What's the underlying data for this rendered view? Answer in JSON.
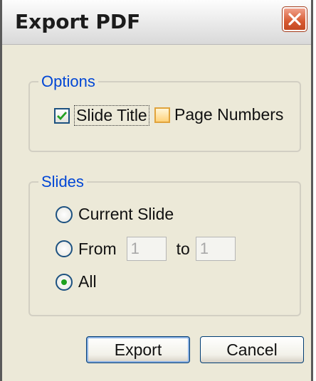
{
  "window": {
    "title": "Export PDF"
  },
  "options_group": {
    "legend": "Options",
    "slide_title": {
      "label": "Slide Title",
      "checked": true
    },
    "page_numbers": {
      "label": "Page Numbers",
      "checked": false
    }
  },
  "slides_group": {
    "legend": "Slides",
    "current_slide": {
      "label": "Current Slide",
      "selected": false
    },
    "from": {
      "label": "From",
      "selected": false,
      "value": "1"
    },
    "to": {
      "label": "to",
      "value": "1"
    },
    "all": {
      "label": "All",
      "selected": true
    }
  },
  "buttons": {
    "export_label": "Export",
    "cancel_label": "Cancel"
  },
  "icons": [
    "close-icon",
    "checkmark-icon"
  ],
  "colors": {
    "legend": "#0046d5",
    "close_button": "#d75a32",
    "radio_selected": "#1fa11f"
  }
}
